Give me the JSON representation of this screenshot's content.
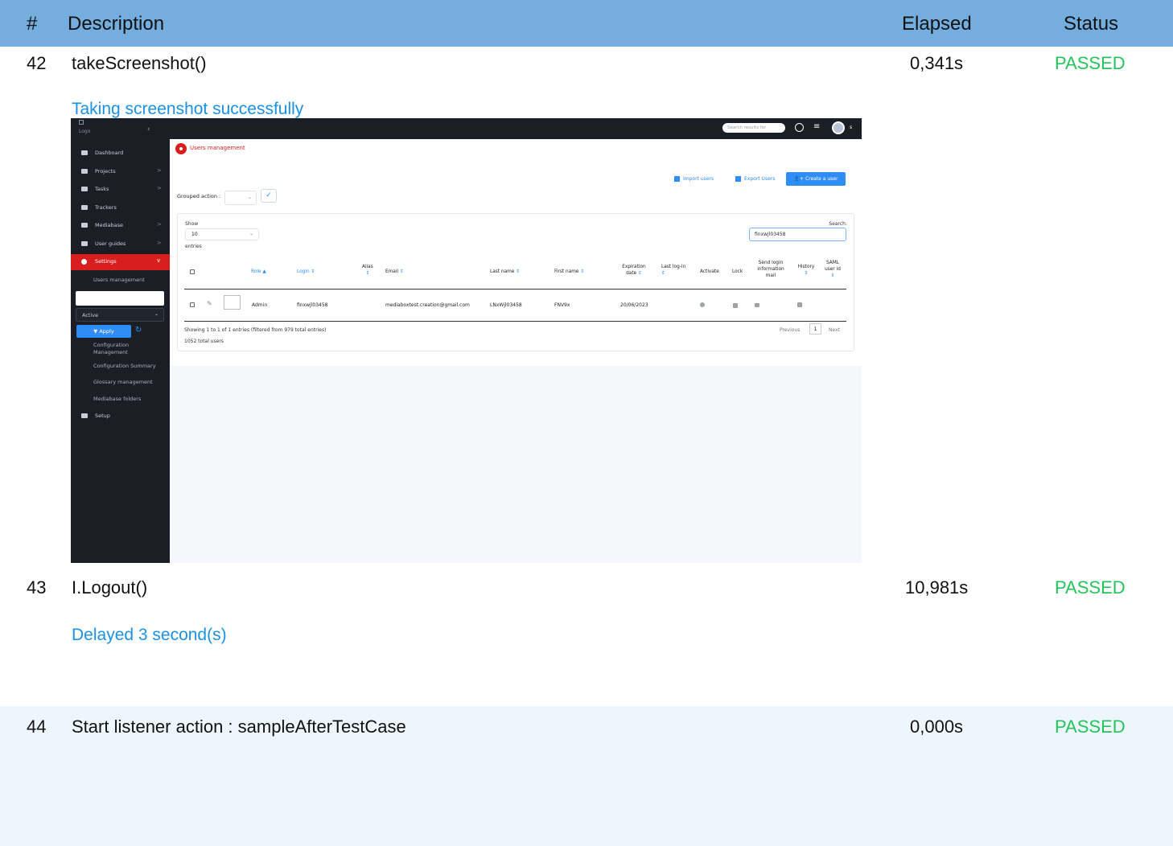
{
  "header": {
    "num": "#",
    "description": "Description",
    "elapsed": "Elapsed",
    "status": "Status"
  },
  "rows": [
    {
      "num": "42",
      "description": "takeScreenshot()",
      "elapsed": "0,341s",
      "status": "PASSED",
      "note": "Taking screenshot successfully"
    },
    {
      "num": "43",
      "description": "I.Logout()",
      "elapsed": "10,981s",
      "status": "PASSED",
      "note": "Delayed 3 second(s)"
    },
    {
      "num": "44",
      "description": "Start listener action : sampleAfterTestCase",
      "elapsed": "0,000s",
      "status": "PASSED"
    }
  ],
  "colors": {
    "header_bg": "#73aedf",
    "alt_row_bg": "#eef6fd",
    "passed": "#25c45b",
    "note": "#1a91e6"
  },
  "screenshot": {
    "logo": "Logo",
    "sidebar": {
      "items": [
        {
          "label": "Dashboard",
          "icon": "dashboard-icon"
        },
        {
          "label": "Projects",
          "icon": "folder-open-icon",
          "chevron": ">"
        },
        {
          "label": "Tasks",
          "icon": "list-icon",
          "chevron": ">"
        },
        {
          "label": "Trackers",
          "icon": "tracker-icon"
        },
        {
          "label": "Mediabase",
          "icon": "media-icon",
          "chevron": ">"
        },
        {
          "label": "User guides",
          "icon": "folder-icon",
          "chevron": ">"
        },
        {
          "label": "Settings",
          "icon": "settings-icon",
          "chevron": "v"
        }
      ],
      "active_sub": "Users management",
      "filter_select": "Active",
      "apply": "Apply",
      "sub_items": [
        "Configuration",
        "Management",
        "Configuration Summary",
        "Glossary management",
        "Mediabase folders"
      ],
      "setup": "Setup"
    },
    "topbar": {
      "search_placeholder": "Search results for",
      "user": "s"
    },
    "breadcrumb": "Users management",
    "toolbar": {
      "import": "Import users",
      "export": "Export Users",
      "create": "Create a user"
    },
    "grouped_action": "Grouped action :",
    "table": {
      "show": "Show",
      "length": "10",
      "entries": "entries",
      "search_label": "Search:",
      "search_value": "finxwjl03458",
      "columns": [
        "Role",
        "Login",
        "Alias",
        "Email",
        "Last name",
        "First name",
        "Expiration date",
        "Last log-in",
        "Activate",
        "Lock",
        "Send login information mail",
        "History",
        "SAML user id"
      ],
      "row": {
        "role": "Admin",
        "login": "finxwjl03458",
        "email": "mediaboxtest.creation@gmail.com",
        "last_name": "LNxWjl03458",
        "first_name": "FNV9x",
        "expiration": "20/06/2023"
      },
      "info": "Showing 1 to 1 of 1 entries (filtered from 979 total entries)",
      "total": "1052 total users",
      "previous": "Previous",
      "page": "1",
      "next": "Next"
    }
  }
}
